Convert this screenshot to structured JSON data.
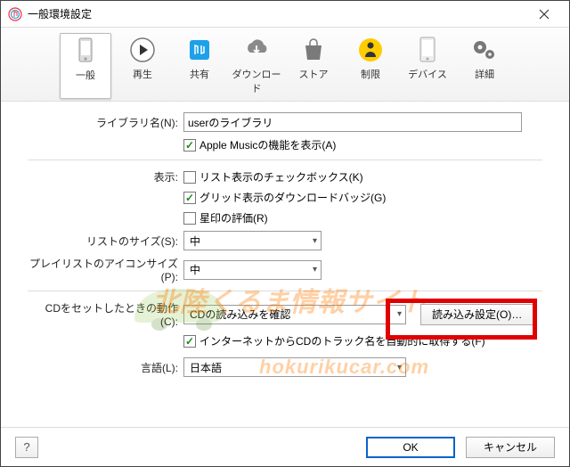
{
  "window": {
    "title": "一般環境設定"
  },
  "tabs": [
    {
      "label": "一般"
    },
    {
      "label": "再生"
    },
    {
      "label": "共有"
    },
    {
      "label": "ダウンロード"
    },
    {
      "label": "ストア"
    },
    {
      "label": "制限"
    },
    {
      "label": "デバイス"
    },
    {
      "label": "詳細"
    }
  ],
  "library": {
    "name_label": "ライブラリ名(N):",
    "name_value": "userのライブラリ",
    "apple_music_label": "Apple Musicの機能を表示(A)"
  },
  "display": {
    "section_label": "表示:",
    "list_checkbox_label": "リスト表示のチェックボックス(K)",
    "grid_badge_label": "グリッド表示のダウンロードバッジ(G)",
    "star_rating_label": "星印の評価(R)"
  },
  "listsize": {
    "label": "リストのサイズ(S):",
    "value": "中"
  },
  "playlistsize": {
    "label": "プレイリストのアイコンサイズ(P):",
    "value": "中"
  },
  "cd": {
    "label": "CDをセットしたときの動作(C):",
    "value": "CDの読み込みを確認",
    "import_button": "読み込み設定(O)…",
    "internet_label": "インターネットからCDのトラック名を自動的に取得する(F)"
  },
  "language": {
    "label": "言語(L):",
    "value": "日本語"
  },
  "footer": {
    "help": "?",
    "ok": "OK",
    "cancel": "キャンセル"
  },
  "watermark": {
    "line1": "北陸くるま情報サイト",
    "line2": "hokurikucar.com"
  }
}
